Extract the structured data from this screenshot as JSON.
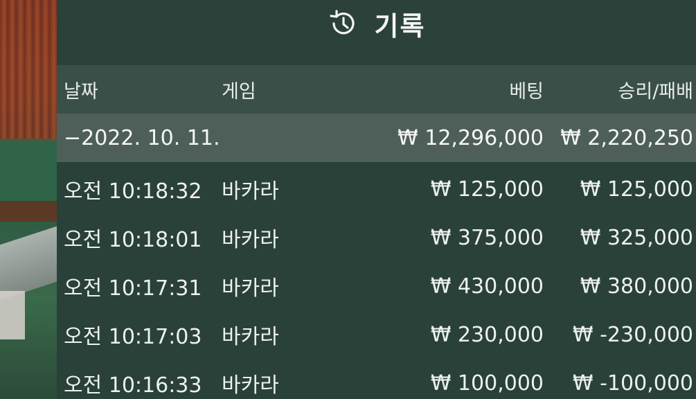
{
  "title_bar": {
    "icon": "history-icon",
    "title": "기록"
  },
  "table": {
    "headers": {
      "date": "날짜",
      "game": "게임",
      "bet": "베팅",
      "result": "승리/패배"
    },
    "summary": {
      "date": "−2022. 10. 11.",
      "bet": "₩ 12,296,000",
      "result": "₩ 2,220,250"
    },
    "rows": [
      {
        "time": "오전 10:18:32",
        "game": "바카라",
        "bet": "₩ 125,000",
        "result": "₩ 125,000"
      },
      {
        "time": "오전 10:18:01",
        "game": "바카라",
        "bet": "₩ 375,000",
        "result": "₩ 325,000"
      },
      {
        "time": "오전 10:17:31",
        "game": "바카라",
        "bet": "₩ 430,000",
        "result": "₩ 380,000"
      },
      {
        "time": "오전 10:17:03",
        "game": "바카라",
        "bet": "₩ 230,000",
        "result": "₩ -230,000"
      },
      {
        "time": "오전 10:16:33",
        "game": "바카라",
        "bet": "₩ 100,000",
        "result": "₩ -100,000"
      }
    ]
  },
  "colors": {
    "panel": "#294139",
    "header_row": "#3a4f48",
    "summary_row": "#4e5f59",
    "text": "#eef1ef"
  }
}
